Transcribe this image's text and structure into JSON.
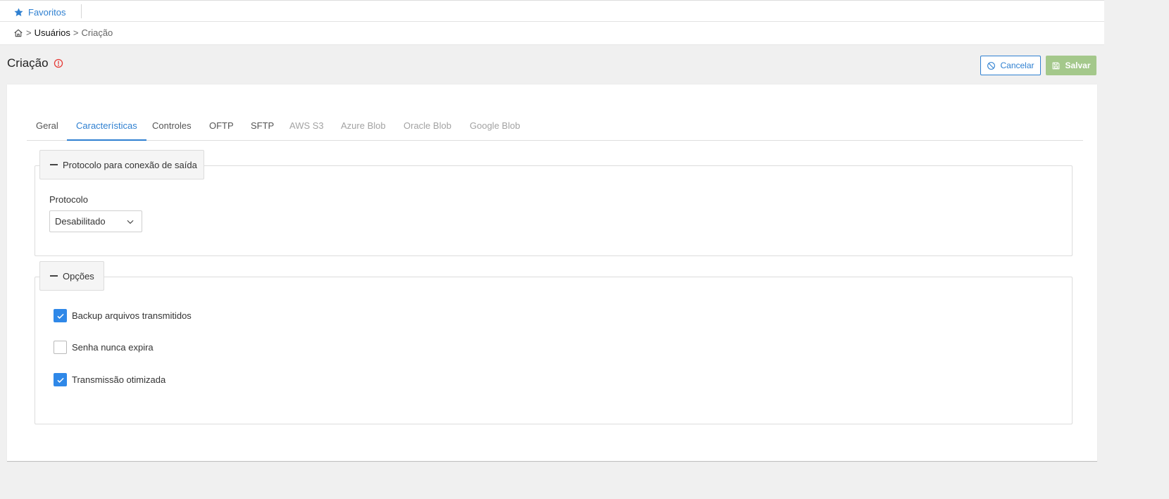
{
  "topbar": {
    "favorites_label": "Favoritos",
    "favorites_icon": "star-icon"
  },
  "breadcrumb": {
    "home_icon": "home-icon",
    "separator": ">",
    "items": [
      "Usuários",
      "Criação"
    ]
  },
  "page": {
    "title": "Criação",
    "title_icon": "alert-circle-icon"
  },
  "actions": {
    "cancel_label": "Cancelar",
    "cancel_icon": "ban-icon",
    "save_label": "Salvar",
    "save_icon": "floppy-disk-icon"
  },
  "tabs": [
    {
      "label": "Geral",
      "state": "enabled"
    },
    {
      "label": "Características",
      "state": "active"
    },
    {
      "label": "Controles",
      "state": "enabled"
    },
    {
      "label": "OFTP",
      "state": "enabled"
    },
    {
      "label": "SFTP",
      "state": "enabled"
    },
    {
      "label": "AWS S3",
      "state": "disabled"
    },
    {
      "label": "Azure Blob",
      "state": "disabled"
    },
    {
      "label": "Oracle Blob",
      "state": "disabled"
    },
    {
      "label": "Google Blob",
      "state": "disabled"
    }
  ],
  "protocol_section": {
    "legend": "Protocolo para conexão de saída",
    "field_label": "Protocolo",
    "select_value": "Desabilitado"
  },
  "options_section": {
    "legend": "Opções",
    "options": [
      {
        "label": "Backup arquivos transmitidos",
        "checked": true
      },
      {
        "label": "Senha nunca expira",
        "checked": false
      },
      {
        "label": "Transmissão otimizada",
        "checked": true
      }
    ]
  },
  "colors": {
    "accent": "#2f80d1",
    "checkbox": "#2f88e8",
    "save_button": "#a4c88b",
    "alert": "#e53935",
    "disabled_tab": "#a3a3a3"
  }
}
